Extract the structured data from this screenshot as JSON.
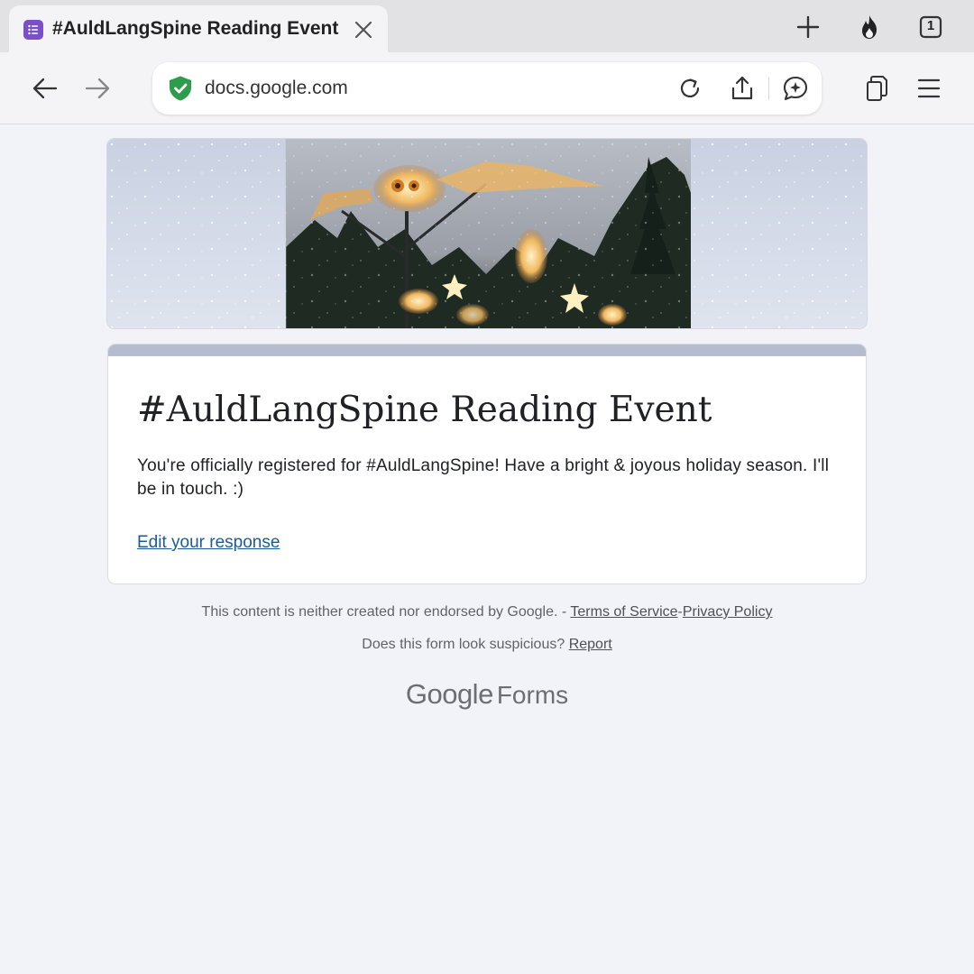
{
  "browser": {
    "tab": {
      "title": "#AuldLangSpine Reading Event",
      "favicon": "forms-list-icon",
      "favicon_color": "#7a4fc8"
    },
    "tab_count": "1",
    "toolbar_icons": [
      "back-arrow-icon",
      "forward-arrow-icon",
      "reload-icon",
      "share-icon",
      "ai-chat-icon",
      "tabs-copy-icon",
      "menu-icon"
    ],
    "address_bar": {
      "url": "docs.google.com",
      "security_icon": "green-shield-check-icon",
      "security_color": "#2e9d4b"
    }
  },
  "form": {
    "title": "#AuldLangSpine Reading Event",
    "message": "You're officially registered for #AuldLangSpine! Have a bright & joyous holiday season. I'll be in touch. :)",
    "edit_link": "Edit your response",
    "accent_color": "#b5bccd"
  },
  "footer": {
    "disclaimer": "This content is neither created nor endorsed by Google.",
    "separator": "-",
    "terms": "Terms of Service",
    "privacy": "Privacy Policy",
    "suspicious": "Does this form look suspicious?",
    "report": "Report",
    "brand_google": "Google",
    "brand_forms": "Forms"
  }
}
